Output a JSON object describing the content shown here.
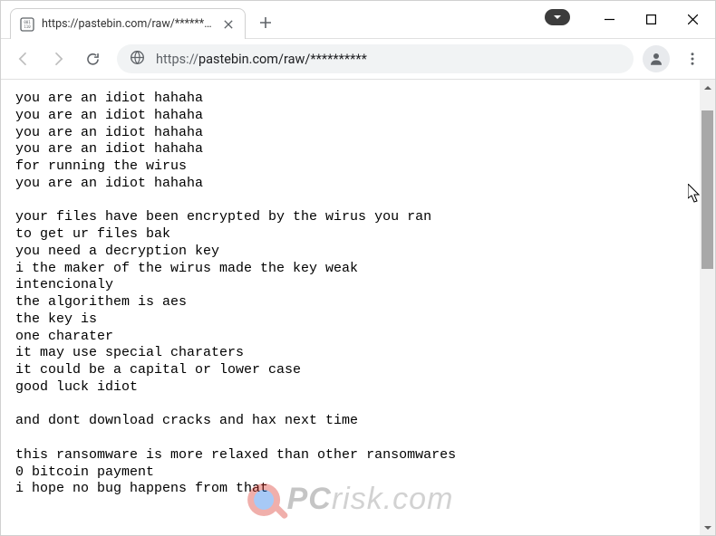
{
  "tab": {
    "title": "https://pastebin.com/raw/**********"
  },
  "address_bar": {
    "scheme": "https://",
    "host_path": "pastebin.com/raw/**********"
  },
  "page_text": "you are an idiot hahaha\nyou are an idiot hahaha\nyou are an idiot hahaha\nyou are an idiot hahaha\nfor running the wirus\nyou are an idiot hahaha\n\nyour files have been encrypted by the wirus you ran\nto get ur files bak\nyou need a decryption key\ni the maker of the wirus made the key weak\nintencionaly\nthe algorithem is aes\nthe key is\none charater\nit may use special charaters\nit could be a capital or lower case\ngood luck idiot\n\nand dont download cracks and hax next time\n\nthis ransomware is more relaxed than other ransomwares\n0 bitcoin payment\ni hope no bug happens from that",
  "watermark": {
    "bold": "PC",
    "light": "risk",
    "tld": ".com"
  }
}
